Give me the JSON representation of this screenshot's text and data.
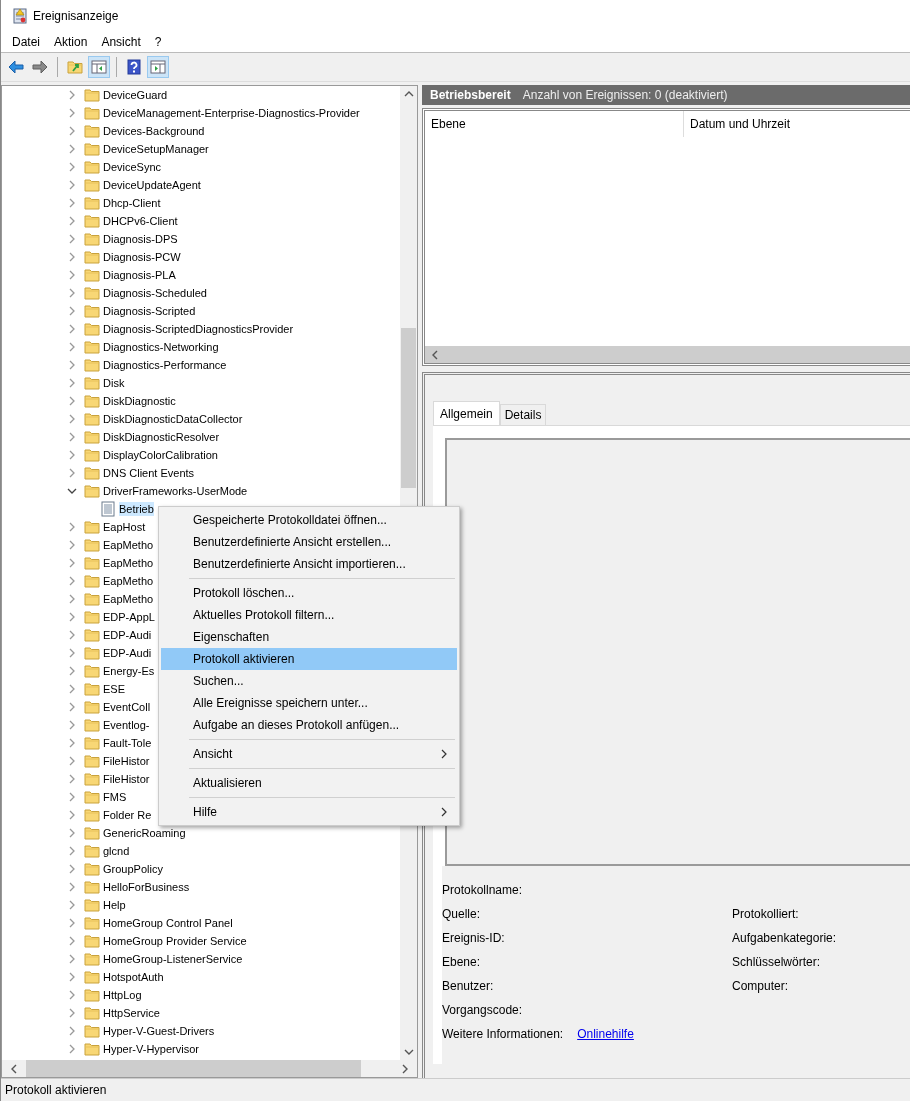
{
  "window": {
    "title": "Ereignisanzeige"
  },
  "menu_bar": [
    "Datei",
    "Aktion",
    "Ansicht",
    "?"
  ],
  "toolbar": [
    {
      "kind": "back",
      "pressed": false
    },
    {
      "kind": "forward",
      "pressed": false
    },
    {
      "kind": "separator"
    },
    {
      "kind": "folder-up",
      "pressed": false
    },
    {
      "kind": "tree-pane",
      "pressed": true
    },
    {
      "kind": "separator"
    },
    {
      "kind": "help",
      "pressed": false
    },
    {
      "kind": "action-pane",
      "pressed": true
    }
  ],
  "tree": [
    {
      "label": "DeviceGuard",
      "expanded": false
    },
    {
      "label": "DeviceManagement-Enterprise-Diagnostics-Provider",
      "expanded": false
    },
    {
      "label": "Devices-Background",
      "expanded": false
    },
    {
      "label": "DeviceSetupManager",
      "expanded": false
    },
    {
      "label": "DeviceSync",
      "expanded": false
    },
    {
      "label": "DeviceUpdateAgent",
      "expanded": false
    },
    {
      "label": "Dhcp-Client",
      "expanded": false
    },
    {
      "label": "DHCPv6-Client",
      "expanded": false
    },
    {
      "label": "Diagnosis-DPS",
      "expanded": false
    },
    {
      "label": "Diagnosis-PCW",
      "expanded": false
    },
    {
      "label": "Diagnosis-PLA",
      "expanded": false
    },
    {
      "label": "Diagnosis-Scheduled",
      "expanded": false
    },
    {
      "label": "Diagnosis-Scripted",
      "expanded": false
    },
    {
      "label": "Diagnosis-ScriptedDiagnosticsProvider",
      "expanded": false
    },
    {
      "label": "Diagnostics-Networking",
      "expanded": false
    },
    {
      "label": "Diagnostics-Performance",
      "expanded": false
    },
    {
      "label": "Disk",
      "expanded": false
    },
    {
      "label": "DiskDiagnostic",
      "expanded": false
    },
    {
      "label": "DiskDiagnosticDataCollector",
      "expanded": false
    },
    {
      "label": "DiskDiagnosticResolver",
      "expanded": false
    },
    {
      "label": "DisplayColorCalibration",
      "expanded": false
    },
    {
      "label": "DNS Client Events",
      "expanded": false
    },
    {
      "label": "DriverFrameworks-UserMode",
      "expanded": true,
      "children": [
        {
          "label": "Betrieb",
          "kind": "log",
          "selected": true
        }
      ]
    },
    {
      "label": "EapHost",
      "expanded": false
    },
    {
      "label": "EapMetho",
      "expanded": false
    },
    {
      "label": "EapMetho",
      "expanded": false
    },
    {
      "label": "EapMetho",
      "expanded": false
    },
    {
      "label": "EapMetho",
      "expanded": false
    },
    {
      "label": "EDP-AppL",
      "expanded": false
    },
    {
      "label": "EDP-Audi",
      "expanded": false
    },
    {
      "label": "EDP-Audi",
      "expanded": false
    },
    {
      "label": "Energy-Es",
      "expanded": false
    },
    {
      "label": "ESE",
      "expanded": false
    },
    {
      "label": "EventColl",
      "expanded": false
    },
    {
      "label": "Eventlog-",
      "expanded": false
    },
    {
      "label": "Fault-Tole",
      "expanded": false
    },
    {
      "label": "FileHistor",
      "expanded": false
    },
    {
      "label": "FileHistor",
      "expanded": false
    },
    {
      "label": "FMS",
      "expanded": false
    },
    {
      "label": "Folder Re",
      "expanded": false
    },
    {
      "label": "GenericRoaming",
      "expanded": false
    },
    {
      "label": "glcnd",
      "expanded": false
    },
    {
      "label": "GroupPolicy",
      "expanded": false
    },
    {
      "label": "HelloForBusiness",
      "expanded": false
    },
    {
      "label": "Help",
      "expanded": false
    },
    {
      "label": "HomeGroup Control Panel",
      "expanded": false
    },
    {
      "label": "HomeGroup Provider Service",
      "expanded": false
    },
    {
      "label": "HomeGroup-ListenerService",
      "expanded": false
    },
    {
      "label": "HotspotAuth",
      "expanded": false
    },
    {
      "label": "HttpLog",
      "expanded": false
    },
    {
      "label": "HttpService",
      "expanded": false
    },
    {
      "label": "Hyper-V-Guest-Drivers",
      "expanded": false
    },
    {
      "label": "Hyper-V-Hypervisor",
      "expanded": false
    }
  ],
  "context_menu": {
    "groups": [
      [
        {
          "label": "Gespeicherte Protokolldatei öffnen...",
          "submenu": false,
          "selected": false
        },
        {
          "label": "Benutzerdefinierte Ansicht erstellen...",
          "submenu": false,
          "selected": false
        },
        {
          "label": "Benutzerdefinierte Ansicht importieren...",
          "submenu": false,
          "selected": false
        }
      ],
      [
        {
          "label": "Protokoll löschen...",
          "submenu": false,
          "selected": false
        },
        {
          "label": "Aktuelles Protokoll filtern...",
          "submenu": false,
          "selected": false
        },
        {
          "label": "Eigenschaften",
          "submenu": false,
          "selected": false
        },
        {
          "label": "Protokoll aktivieren",
          "submenu": false,
          "selected": true
        },
        {
          "label": "Suchen...",
          "submenu": false,
          "selected": false
        },
        {
          "label": "Alle Ereignisse speichern unter...",
          "submenu": false,
          "selected": false
        },
        {
          "label": "Aufgabe an dieses Protokoll anfügen...",
          "submenu": false,
          "selected": false
        }
      ],
      [
        {
          "label": "Ansicht",
          "submenu": true,
          "selected": false
        }
      ],
      [
        {
          "label": "Aktualisieren",
          "submenu": false,
          "selected": false
        }
      ],
      [
        {
          "label": "Hilfe",
          "submenu": true,
          "selected": false
        }
      ]
    ]
  },
  "log_header": {
    "title": "Betriebsbereit",
    "info": "Anzahl von Ereignissen: 0 (deaktiviert)"
  },
  "event_table": {
    "columns": [
      "Ebene",
      "Datum und Uhrzeit"
    ]
  },
  "preview": {
    "tabs": [
      {
        "label": "Allgemein",
        "selected": true
      },
      {
        "label": "Details",
        "selected": false
      }
    ],
    "fields_left": [
      "Protokollname:",
      "Quelle:",
      "Ereignis-ID:",
      "Ebene:",
      "Benutzer:",
      "Vorgangscode:"
    ],
    "fields_right": [
      "Protokolliert:",
      "Aufgabenkategorie:",
      "Schlüsselwörter:",
      "Computer:"
    ],
    "more_info": {
      "label": "Weitere Informationen:",
      "link": "Onlinehilfe"
    }
  },
  "status_bar": "Protokoll aktivieren"
}
